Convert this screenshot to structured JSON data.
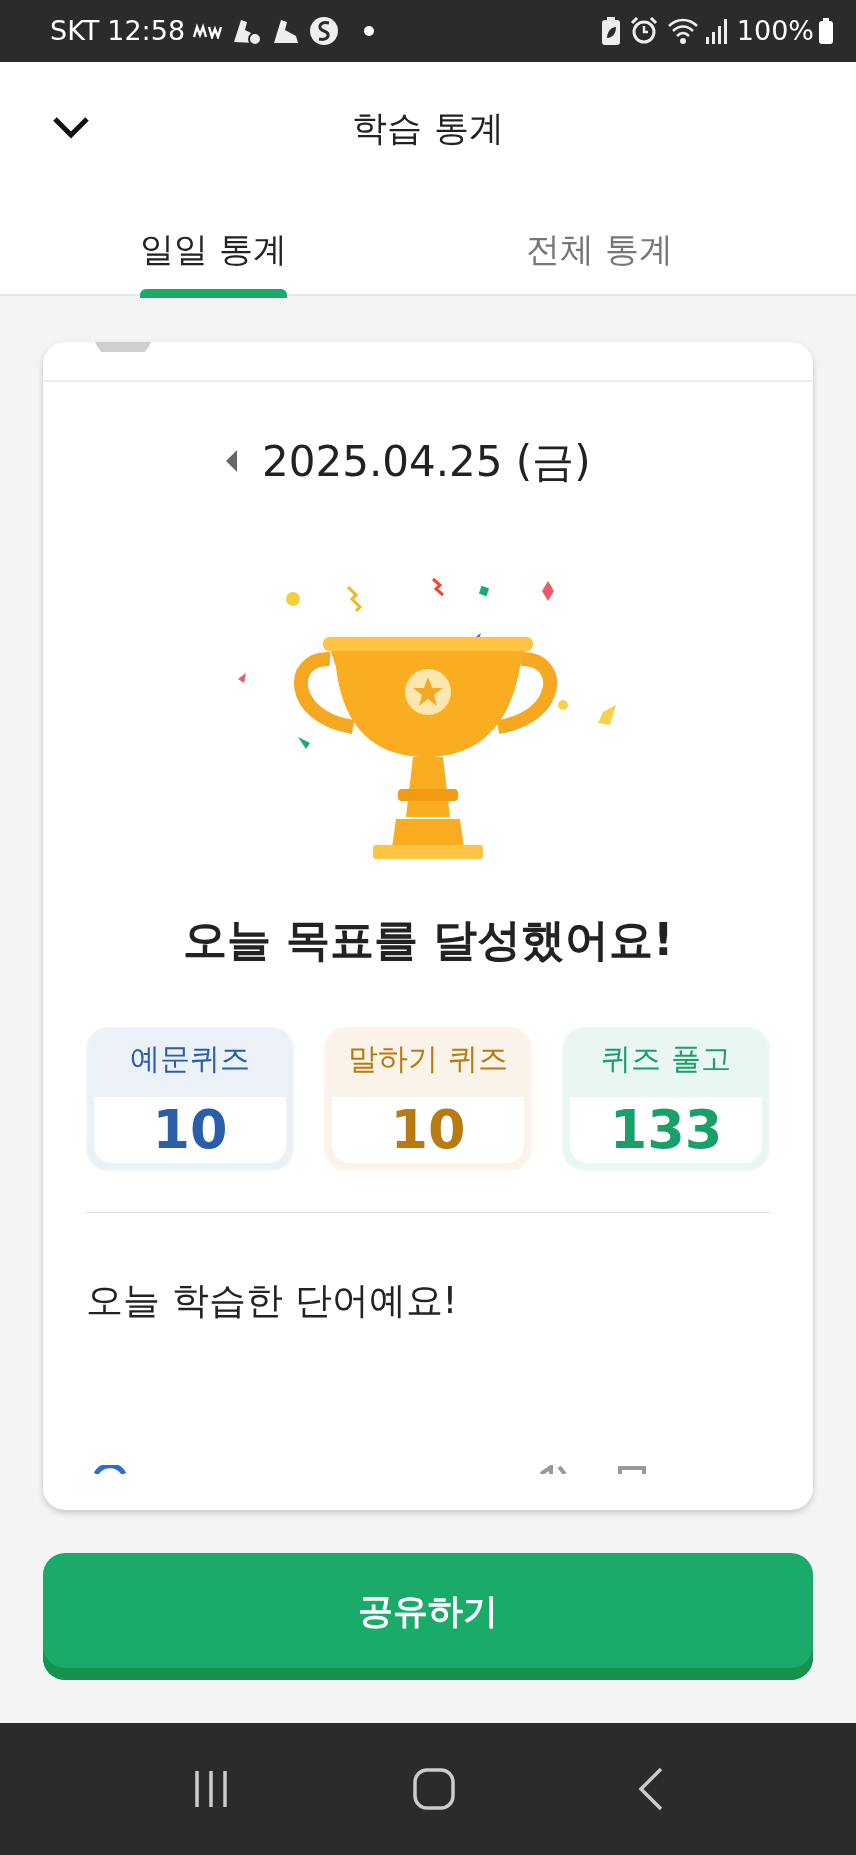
{
  "status_bar": {
    "carrier": "SKT",
    "time": "12:58",
    "battery": "100%"
  },
  "header": {
    "title": "학습 통계"
  },
  "tabs": [
    {
      "label": "일일 통계",
      "selected": true
    },
    {
      "label": "전체 통계",
      "selected": false
    }
  ],
  "card": {
    "date": "2025.04.25 (금)",
    "headline": "오늘 목표를 달성했어요!",
    "stats": [
      {
        "label": "예문퀴즈",
        "value": "10",
        "color": "#2a5ea8"
      },
      {
        "label": "말하기 퀴즈",
        "value": "10",
        "color": "#b87a12"
      },
      {
        "label": "퀴즈 풀고",
        "value": "133",
        "color": "#1a9e6a"
      }
    ],
    "words_title": "오늘 학습한 단어예요!"
  },
  "share_button": {
    "label": "공유하기"
  }
}
